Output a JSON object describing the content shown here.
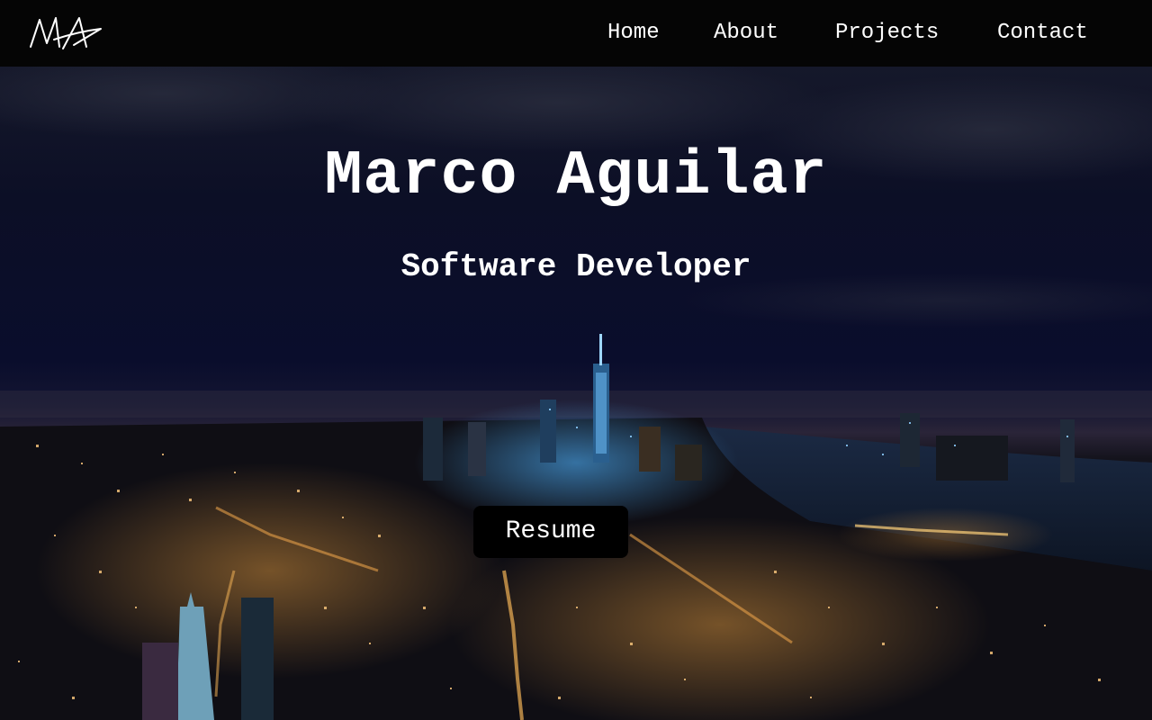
{
  "nav": {
    "logo_text": "MA",
    "links": [
      {
        "label": "Home"
      },
      {
        "label": "About"
      },
      {
        "label": "Projects"
      },
      {
        "label": "Contact"
      }
    ]
  },
  "hero": {
    "title": "Marco Aguilar",
    "subtitle": "Software Developer",
    "resume_label": "Resume"
  },
  "colors": {
    "navbar_bg": "#050505",
    "sky": "#0b0f2a",
    "button_bg": "#000000",
    "text": "#ffffff"
  }
}
